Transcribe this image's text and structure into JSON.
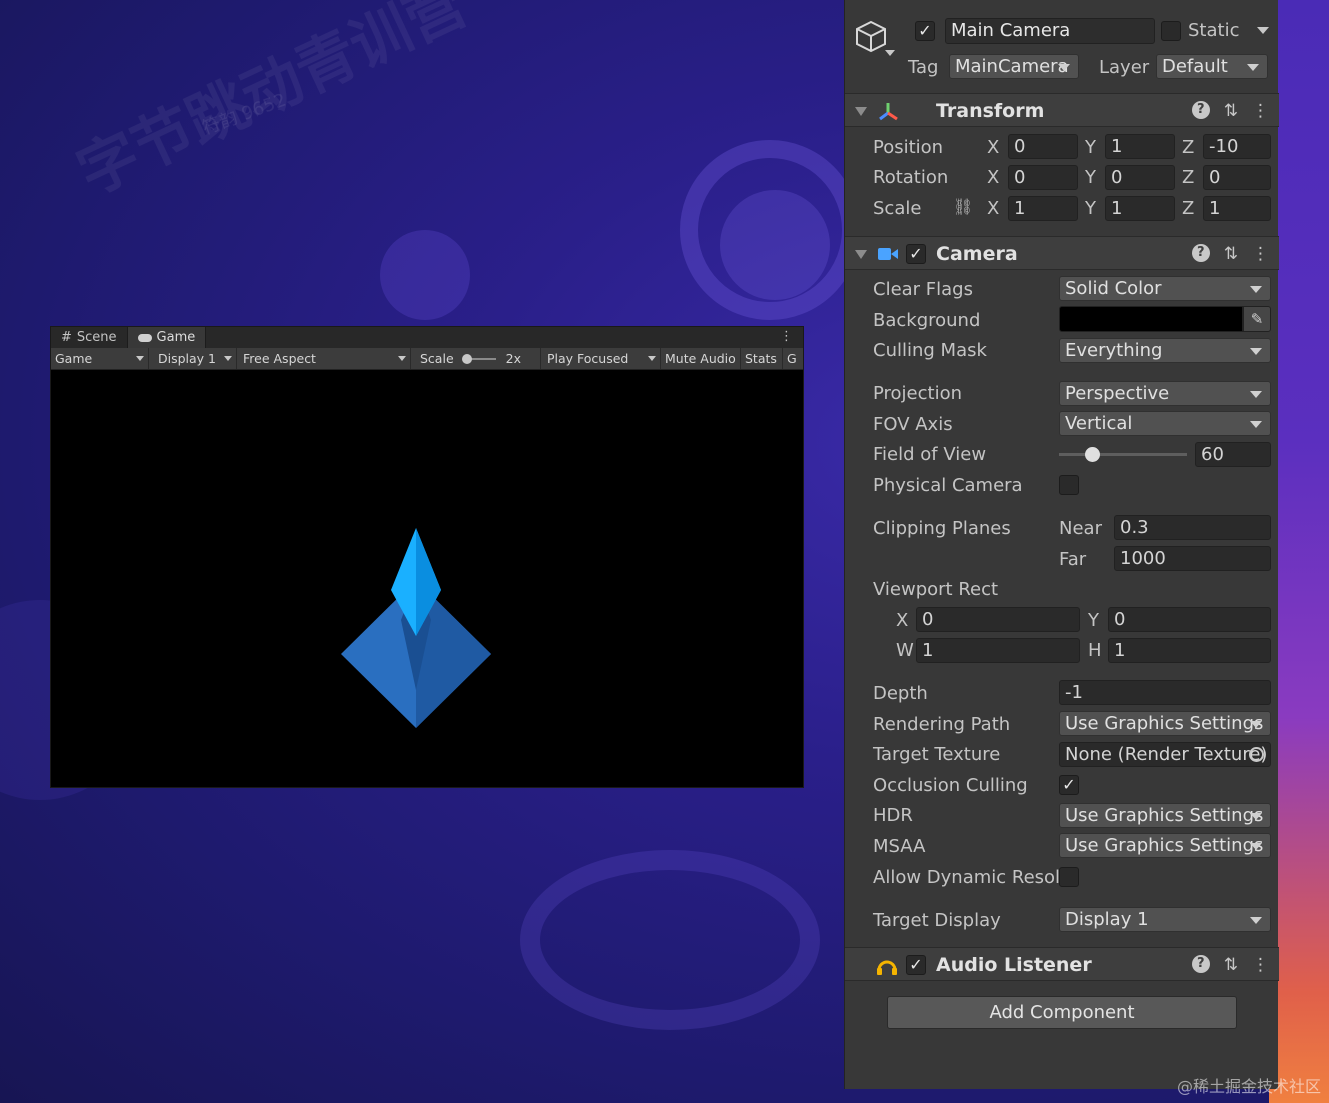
{
  "game_window": {
    "tabs": [
      {
        "label": "Scene",
        "icon": "grid-icon"
      },
      {
        "label": "Game",
        "icon": "gamepad-icon"
      }
    ],
    "toolbar": {
      "view_mode": "Game",
      "display": "Display 1",
      "aspect": "Free Aspect",
      "scale_label": "Scale",
      "scale_value": "2x",
      "play_mode": "Play Focused",
      "mute_audio": "Mute Audio",
      "stats": "Stats",
      "gizmos": "G"
    },
    "scene_object": "blue-diamond-crystal"
  },
  "inspector": {
    "object": {
      "active_checked": true,
      "name": "Main Camera",
      "static_label": "Static",
      "static_checked": false,
      "tag_label": "Tag",
      "tag_value": "MainCamera",
      "layer_label": "Layer",
      "layer_value": "Default"
    },
    "transform": {
      "title": "Transform",
      "rows": [
        {
          "label": "Position",
          "x": "0",
          "y": "1",
          "z": "-10"
        },
        {
          "label": "Rotation",
          "x": "0",
          "y": "0",
          "z": "0"
        },
        {
          "label": "Scale",
          "x": "1",
          "y": "1",
          "z": "1"
        }
      ],
      "axis_labels": {
        "x": "X",
        "y": "Y",
        "z": "Z"
      }
    },
    "camera": {
      "title": "Camera",
      "enabled": true,
      "clear_flags_label": "Clear Flags",
      "clear_flags_value": "Solid Color",
      "background_label": "Background",
      "background_color": "#000000",
      "culling_mask_label": "Culling Mask",
      "culling_mask_value": "Everything",
      "projection_label": "Projection",
      "projection_value": "Perspective",
      "fov_axis_label": "FOV Axis",
      "fov_axis_value": "Vertical",
      "fov_label": "Field of View",
      "fov_value": "60",
      "fov_slider_fraction": 0.26,
      "physical_camera_label": "Physical Camera",
      "physical_camera_checked": false,
      "clipping_planes_label": "Clipping Planes",
      "near_label": "Near",
      "near_value": "0.3",
      "far_label": "Far",
      "far_value": "1000",
      "viewport_rect_label": "Viewport Rect",
      "viewport": {
        "x": "0",
        "y": "0",
        "w": "1",
        "h": "1"
      },
      "viewport_axis_labels": {
        "x": "X",
        "y": "Y",
        "w": "W",
        "h": "H"
      },
      "depth_label": "Depth",
      "depth_value": "-1",
      "rendering_path_label": "Rendering Path",
      "rendering_path_value": "Use Graphics Settings",
      "target_texture_label": "Target Texture",
      "target_texture_value": "None (Render Texture)",
      "occlusion_culling_label": "Occlusion Culling",
      "occlusion_culling_checked": true,
      "hdr_label": "HDR",
      "hdr_value": "Use Graphics Settings",
      "msaa_label": "MSAA",
      "msaa_value": "Use Graphics Settings",
      "dynamic_res_label": "Allow Dynamic Resol",
      "dynamic_res_checked": false,
      "target_display_label": "Target Display",
      "target_display_value": "Display 1"
    },
    "audio_listener": {
      "title": "Audio Listener",
      "enabled": true
    },
    "add_component_label": "Add Component",
    "check_mark": "✓"
  },
  "watermark": {
    "corner_text": "@稀土掘金技术社区",
    "repeat_text": "字节跳动青训营",
    "repeat_sub": "符韵 9652"
  },
  "colors": {
    "inspector_bg": "#383838",
    "field_bg": "#2a2a2a",
    "dropdown_bg": "#515151",
    "camera_icon": "#4aa3ff",
    "audio_icon": "#f5b400",
    "crystal_light": "#1aa8f5",
    "crystal_dark": "#1d5fa8"
  }
}
